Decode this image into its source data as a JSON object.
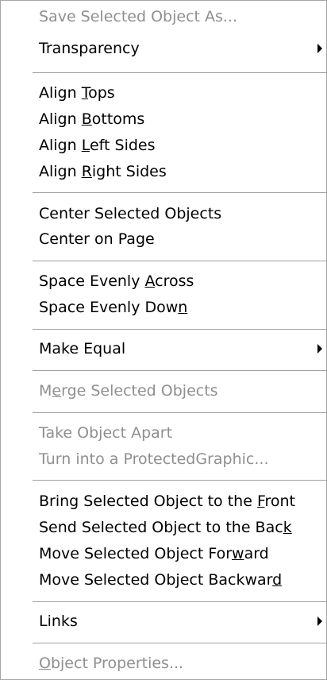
{
  "menu": {
    "items": [
      {
        "pre": "Save Selected Object As...",
        "u": "",
        "post": "",
        "enabled": false,
        "submenu": false
      },
      {
        "pre": "Transparency",
        "u": "",
        "post": "",
        "enabled": true,
        "submenu": true
      },
      {
        "pre": "Align ",
        "u": "T",
        "post": "ops",
        "enabled": true,
        "submenu": false
      },
      {
        "pre": "Align ",
        "u": "B",
        "post": "ottoms",
        "enabled": true,
        "submenu": false
      },
      {
        "pre": "Align ",
        "u": "L",
        "post": "eft Sides",
        "enabled": true,
        "submenu": false
      },
      {
        "pre": "Align ",
        "u": "R",
        "post": "ight Sides",
        "enabled": true,
        "submenu": false
      },
      {
        "pre": "Center Selected Objects",
        "u": "",
        "post": "",
        "enabled": true,
        "submenu": false
      },
      {
        "pre": "Center on Page",
        "u": "",
        "post": "",
        "enabled": true,
        "submenu": false
      },
      {
        "pre": "Space Evenly ",
        "u": "A",
        "post": "cross",
        "enabled": true,
        "submenu": false
      },
      {
        "pre": "Space Evenly Dow",
        "u": "n",
        "post": "",
        "enabled": true,
        "submenu": false
      },
      {
        "pre": "Make Equal",
        "u": "",
        "post": "",
        "enabled": true,
        "submenu": true
      },
      {
        "pre": "M",
        "u": "e",
        "post": "rge Selected Objects",
        "enabled": false,
        "submenu": false
      },
      {
        "pre": "Take Object Apart",
        "u": "",
        "post": "",
        "enabled": false,
        "submenu": false
      },
      {
        "pre": "Turn into a ProtectedGraphic...",
        "u": "",
        "post": "",
        "enabled": false,
        "submenu": false
      },
      {
        "pre": "Bring Selected Object to the ",
        "u": "F",
        "post": "ront",
        "enabled": true,
        "submenu": false
      },
      {
        "pre": "Send Selected Object to the Bac",
        "u": "k",
        "post": "",
        "enabled": true,
        "submenu": false
      },
      {
        "pre": "Move Selected Object For",
        "u": "w",
        "post": "ard",
        "enabled": true,
        "submenu": false
      },
      {
        "pre": "Move Selected Object Backwar",
        "u": "d",
        "post": "",
        "enabled": true,
        "submenu": false
      },
      {
        "pre": "Links",
        "u": "",
        "post": "",
        "enabled": true,
        "submenu": true
      },
      {
        "pre": "",
        "u": "O",
        "post": "bject Properties...",
        "enabled": false,
        "submenu": false
      }
    ]
  }
}
